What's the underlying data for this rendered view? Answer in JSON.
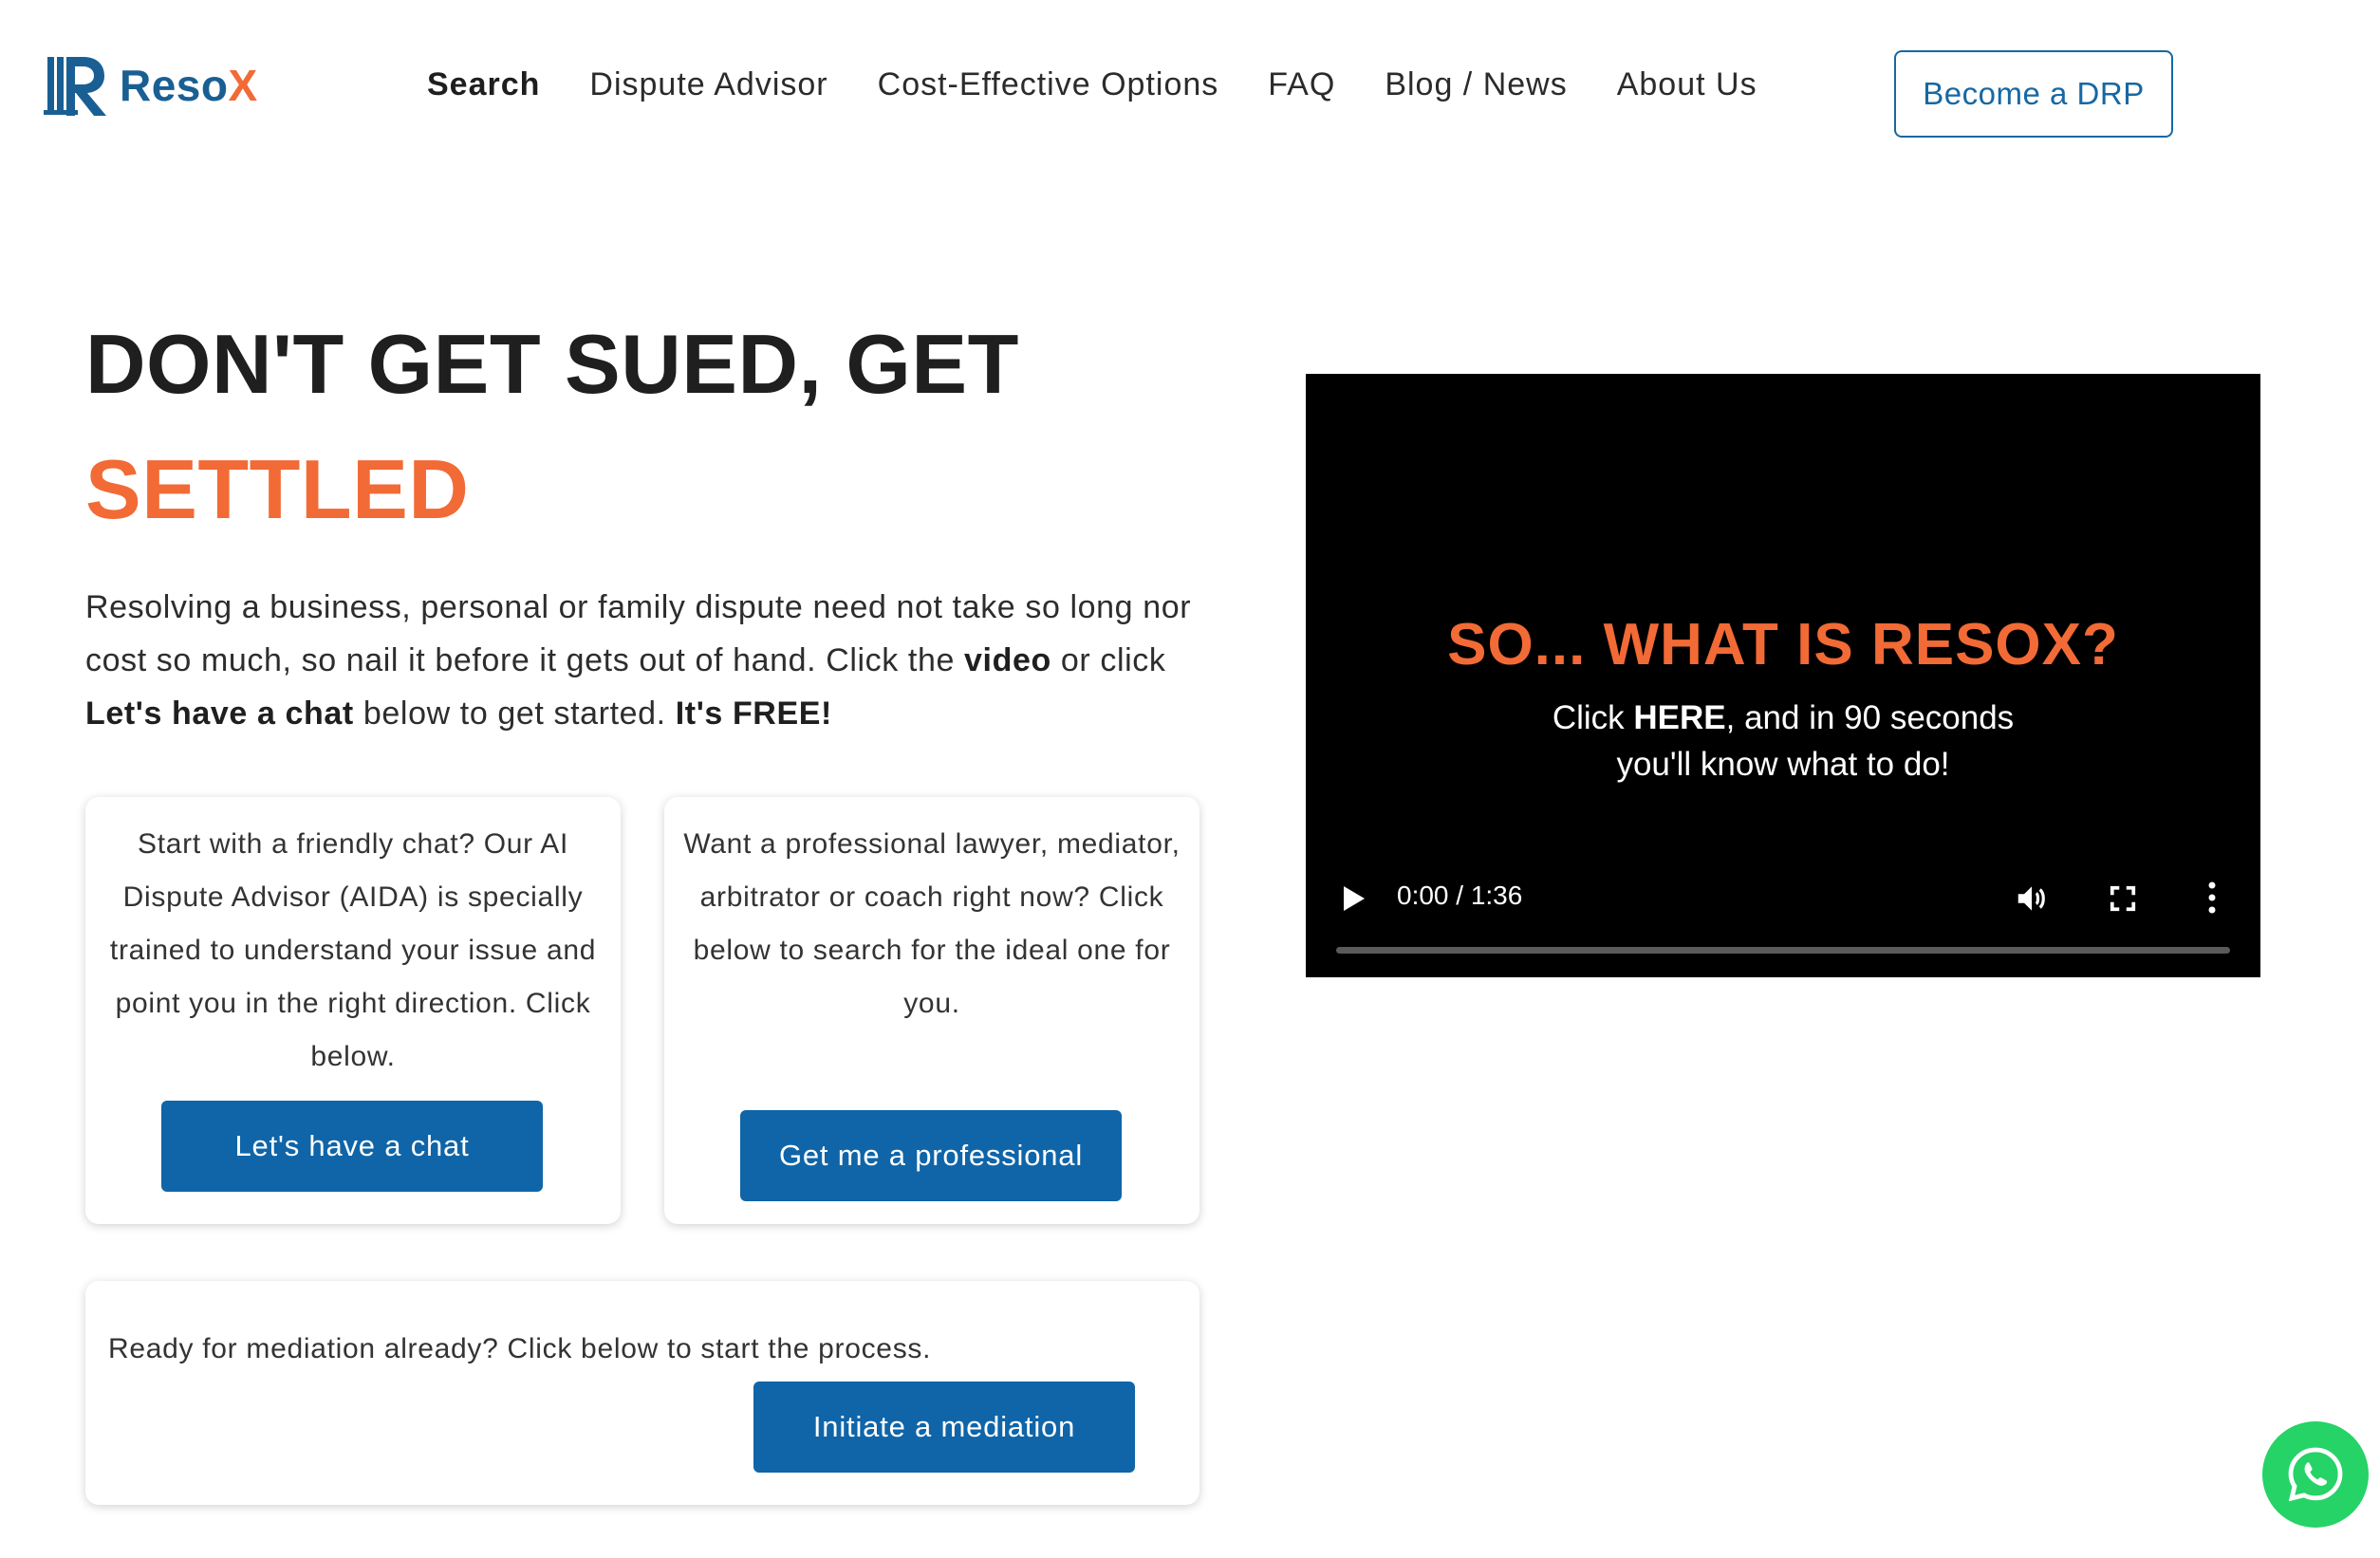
{
  "brand": {
    "name_a": "Reso",
    "name_b": "X",
    "color_primary": "#1a5f93",
    "color_accent": "#f26a35"
  },
  "nav": {
    "items": [
      {
        "label": "Search",
        "active": true
      },
      {
        "label": "Dispute Advisor"
      },
      {
        "label": "Cost-Effective Options"
      },
      {
        "label": "FAQ"
      },
      {
        "label": "Blog / News"
      },
      {
        "label": "About Us"
      }
    ],
    "cta_label": "Become a DRP"
  },
  "hero": {
    "title_line1": "DON'T GET SUED, GET",
    "title_line2": "SETTLED",
    "intro_1": "Resolving a business, personal or family dispute need not take so long nor cost so much, so nail it before it gets out of hand. Click the ",
    "intro_video": "video",
    "intro_2": " or click ",
    "intro_chat": "Let's have a chat",
    "intro_3": " below to get started. ",
    "intro_free": "It's FREE!"
  },
  "cards": {
    "chat": {
      "text": "Start with a friendly chat? Our AI Dispute Advisor (AIDA) is specially trained to understand your issue and point you in the right direction. Click below.",
      "button": "Let's have a chat"
    },
    "professional": {
      "text": "Want a professional lawyer, mediator, arbitrator or coach right now? Click below to search for the ideal one for you.",
      "button": "Get me a professional"
    },
    "mediation": {
      "text": "Ready for mediation already? Click below to start the process.",
      "button": "Initiate a mediation"
    }
  },
  "video": {
    "title": "SO... WHAT IS RESOX?",
    "sub_1": "Click ",
    "sub_here": "HERE",
    "sub_2": ", and in 90 seconds",
    "sub_3": "you'll know what to do!",
    "time": "0:00 / 1:36",
    "progress": 0
  },
  "icons": {
    "logo": "resox-logo-icon",
    "play": "play-icon",
    "volume": "volume-icon",
    "fullscreen": "fullscreen-icon",
    "more": "more-vertical-icon",
    "whatsapp": "whatsapp-icon"
  }
}
